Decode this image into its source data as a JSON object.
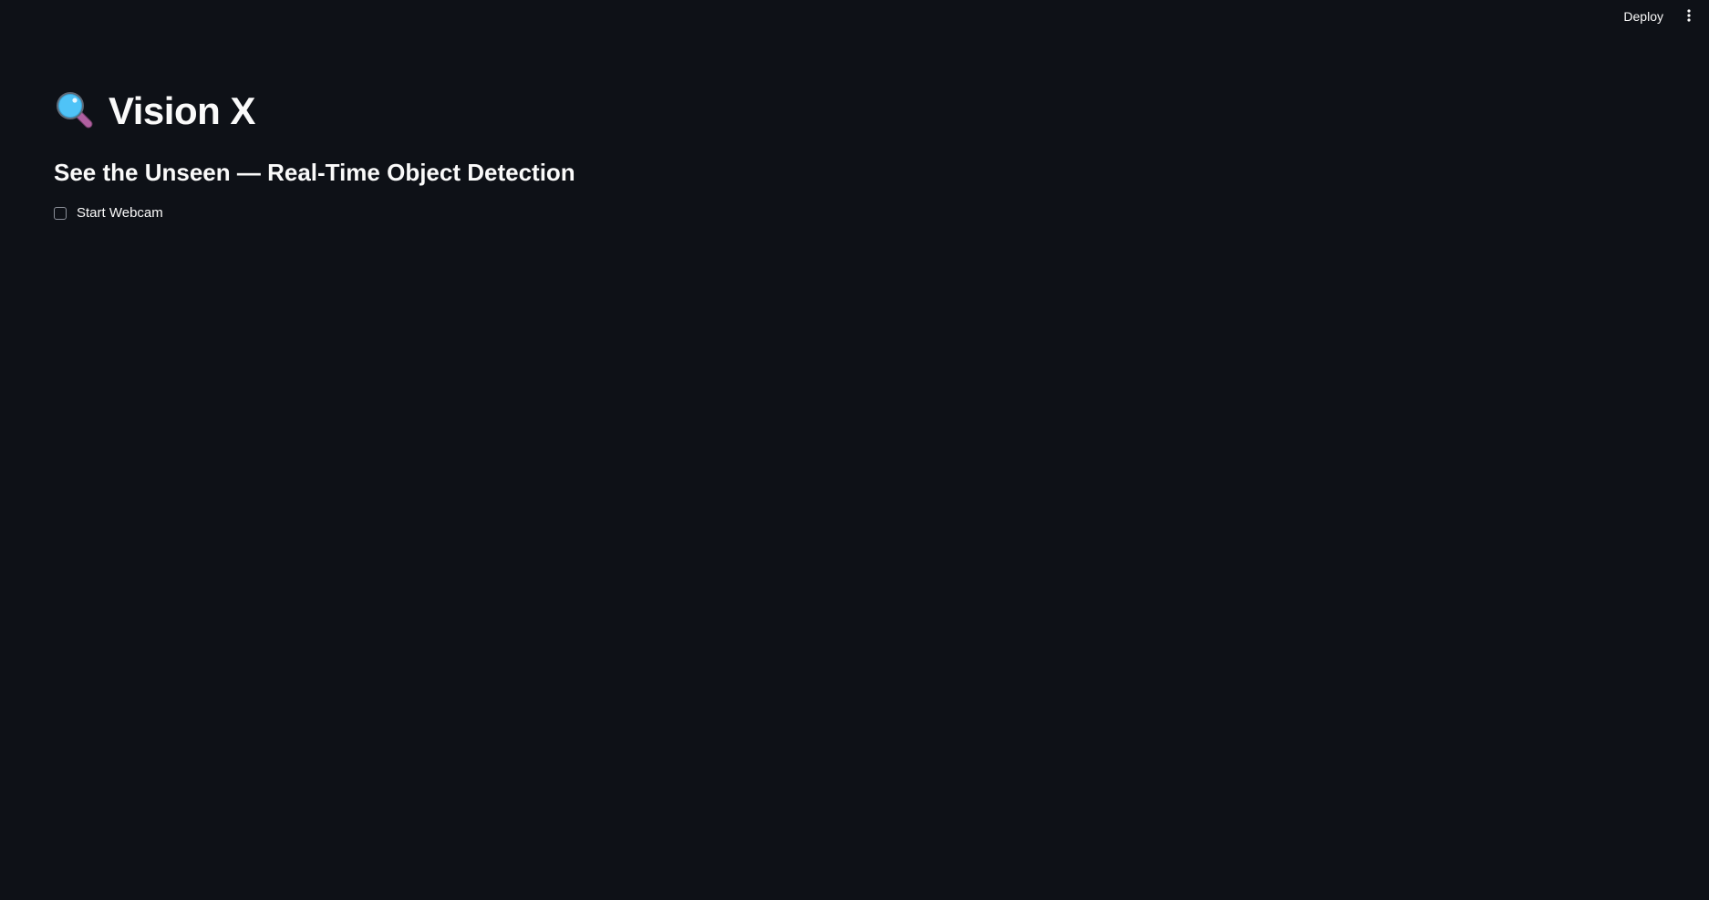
{
  "toolbar": {
    "deploy_label": "Deploy",
    "menu_icon": "kebab-menu-icon"
  },
  "main": {
    "title_icon": "magnifying-glass-icon",
    "title": "Vision X",
    "subtitle": "See the Unseen — Real-Time Object Detection",
    "checkbox": {
      "label": "Start Webcam",
      "checked": false
    }
  },
  "colors": {
    "background": "#0e1117",
    "text": "#fafafa",
    "checkbox_border": "#8b8f99",
    "icon_lens": "#4fc3f7",
    "icon_handle": "#b05fa0"
  }
}
